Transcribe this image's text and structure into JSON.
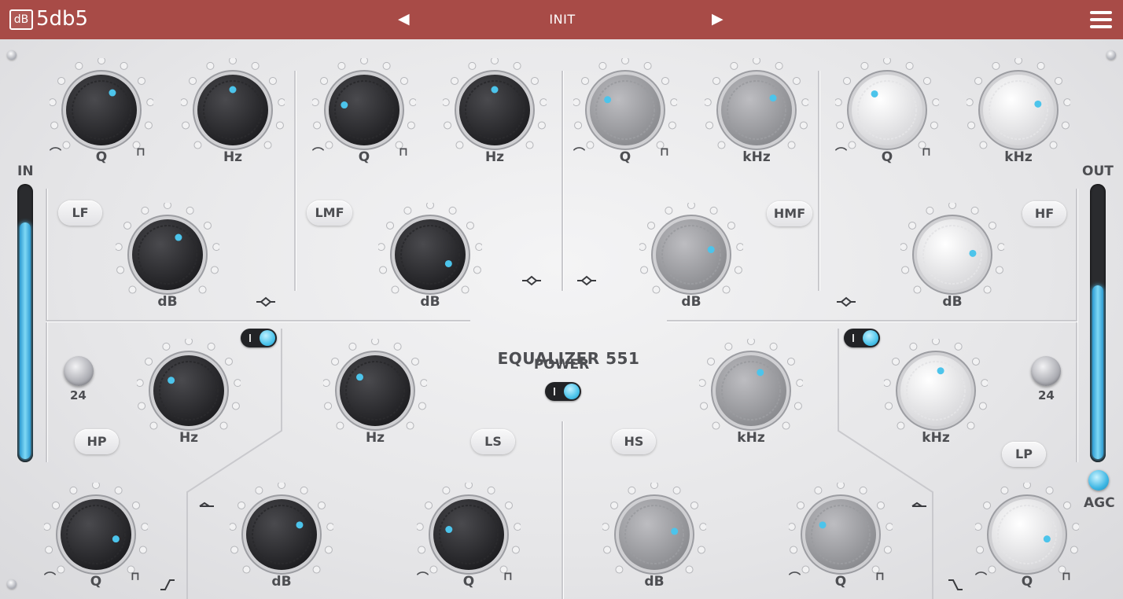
{
  "header": {
    "logo_mark": "dB",
    "brand": "5db5",
    "preset_prev": "◀",
    "preset_name": "INIT",
    "preset_next": "▶"
  },
  "title": "EQUALIZER  551",
  "power": {
    "label": "POWER",
    "on": true
  },
  "meters": {
    "in": {
      "label": "IN",
      "level": 0.87
    },
    "out": {
      "label": "OUT",
      "level": 0.64
    },
    "agc_label": "AGC"
  },
  "bands": {
    "lf": "LF",
    "lmf": "LMF",
    "hmf": "HMF",
    "hf": "HF",
    "hp": "HP",
    "ls": "LS",
    "hs": "HS",
    "lp": "LP"
  },
  "slopes": {
    "hp": "24",
    "lp": "24"
  },
  "knobs": [
    {
      "id": "lf-q",
      "label": "Q",
      "shape_marks": true,
      "tone": "dark",
      "value": 0.62
    },
    {
      "id": "lf-freq",
      "label": "Hz",
      "tone": "dark",
      "value": 0.5
    },
    {
      "id": "lf-gain",
      "label": "dB",
      "tone": "dark",
      "value": 0.62
    },
    {
      "id": "lmf-q",
      "label": "Q",
      "shape_marks": true,
      "tone": "dark",
      "value": 0.22
    },
    {
      "id": "lmf-freq",
      "label": "Hz",
      "tone": "dark",
      "value": 0.5
    },
    {
      "id": "lmf-gain",
      "label": "dB",
      "tone": "dark",
      "value": 0.93
    },
    {
      "id": "hmf-q",
      "label": "Q",
      "shape_marks": true,
      "tone": "mid",
      "value": 0.28
    },
    {
      "id": "hmf-freq",
      "label": "kHz",
      "tone": "mid",
      "value": 0.7
    },
    {
      "id": "hmf-gain",
      "label": "dB",
      "tone": "mid",
      "value": 0.78
    },
    {
      "id": "hf-q",
      "label": "Q",
      "shape_marks": true,
      "tone": "light",
      "value": 0.36
    },
    {
      "id": "hf-freq",
      "label": "kHz",
      "tone": "light",
      "value": 0.77
    },
    {
      "id": "hf-gain",
      "label": "dB",
      "tone": "light",
      "value": 0.82
    },
    {
      "id": "hp-freq",
      "label": "Hz",
      "tone": "dark",
      "value": 0.28
    },
    {
      "id": "ls-freq",
      "label": "Hz",
      "tone": "dark",
      "value": 0.32
    },
    {
      "id": "hs-freq",
      "label": "kHz",
      "tone": "mid",
      "value": 0.6
    },
    {
      "id": "lp-freq",
      "label": "kHz",
      "tone": "light",
      "value": 0.55
    },
    {
      "id": "hp-q",
      "label": "Q",
      "shape_marks": true,
      "tone": "dark",
      "value": 0.88
    },
    {
      "id": "ls-gain",
      "label": "dB",
      "tone": "dark",
      "value": 0.73
    },
    {
      "id": "ls-q",
      "label": "Q",
      "shape_marks": true,
      "tone": "dark",
      "value": 0.22
    },
    {
      "id": "hs-gain",
      "label": "dB",
      "tone": "mid",
      "value": 0.8
    },
    {
      "id": "hs-q",
      "label": "Q",
      "shape_marks": true,
      "tone": "mid",
      "value": 0.27
    },
    {
      "id": "lp-q",
      "label": "Q",
      "shape_marks": true,
      "tone": "light",
      "value": 0.88
    }
  ],
  "colors": {
    "header": "#a84b47",
    "accent": "#4cc4eb",
    "label": "#4d4e52"
  }
}
